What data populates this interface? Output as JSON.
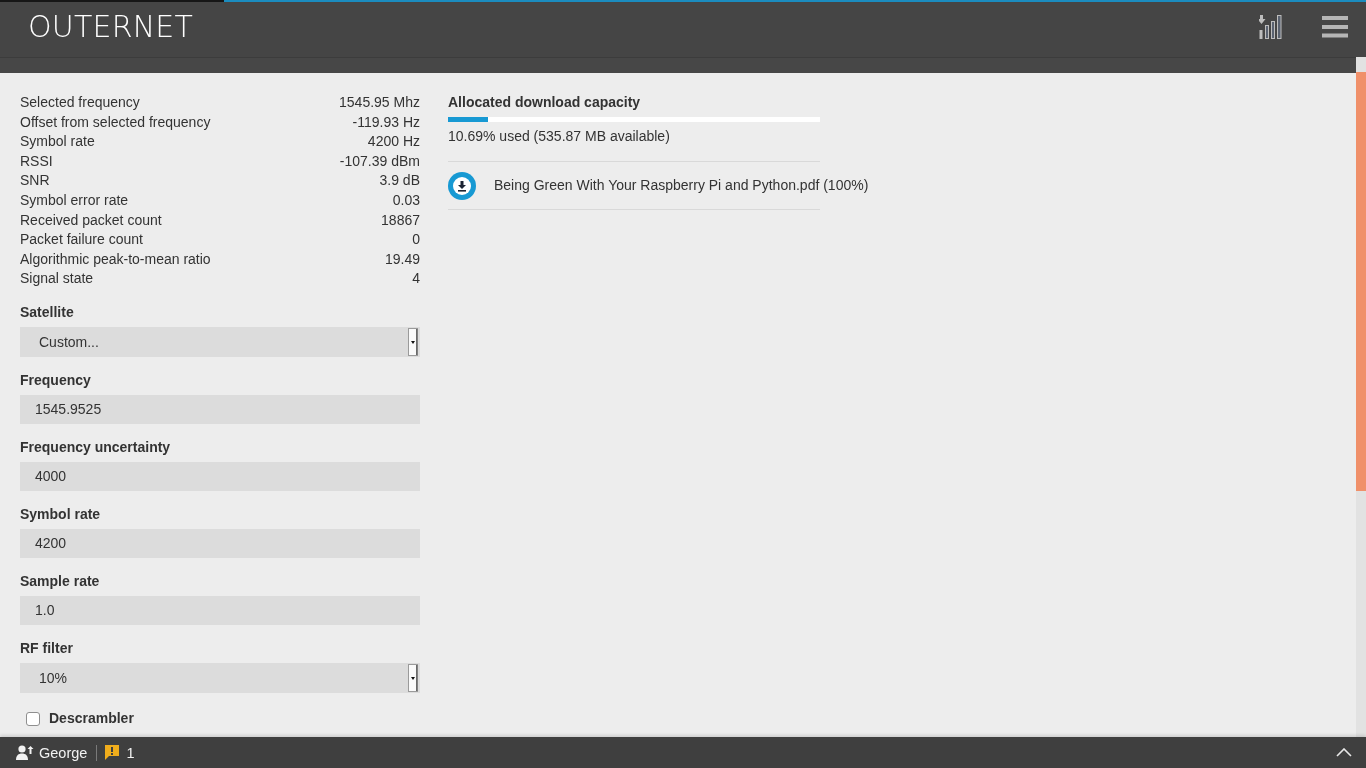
{
  "header": {
    "logo": "OUTERNET"
  },
  "stats": [
    {
      "label": "Selected frequency",
      "value": "1545.95 Mhz"
    },
    {
      "label": "Offset from selected frequency",
      "value": "-119.93 Hz"
    },
    {
      "label": "Symbol rate",
      "value": "4200 Hz"
    },
    {
      "label": "RSSI",
      "value": "-107.39 dBm"
    },
    {
      "label": "SNR",
      "value": "3.9 dB"
    },
    {
      "label": "Symbol error rate",
      "value": "0.03"
    },
    {
      "label": "Received packet count",
      "value": "18867"
    },
    {
      "label": "Packet failure count",
      "value": "0"
    },
    {
      "label": "Algorithmic peak-to-mean ratio",
      "value": "19.49"
    },
    {
      "label": "Signal state",
      "value": "4"
    }
  ],
  "settings": [
    {
      "kind": "select",
      "label": "Satellite",
      "value": "Custom..."
    },
    {
      "kind": "input",
      "label": "Frequency",
      "value": "1545.9525"
    },
    {
      "kind": "input",
      "label": "Frequency uncertainty",
      "value": "4000"
    },
    {
      "kind": "input",
      "label": "Symbol rate",
      "value": "4200"
    },
    {
      "kind": "input",
      "label": "Sample rate",
      "value": "1.0"
    },
    {
      "kind": "select",
      "label": "RF filter",
      "value": "10%"
    },
    {
      "kind": "checkbox",
      "label": "Descrambler",
      "checked": false
    }
  ],
  "storage": {
    "title": "Allocated download capacity",
    "level": 0.1069,
    "summary": "10.69% used (535.87 MB available)"
  },
  "downloads": [
    {
      "name": "Being Green With Your Raspberry Pi and Python.pdf (100%)"
    }
  ],
  "footer": {
    "user": "George",
    "notifications": "1"
  }
}
